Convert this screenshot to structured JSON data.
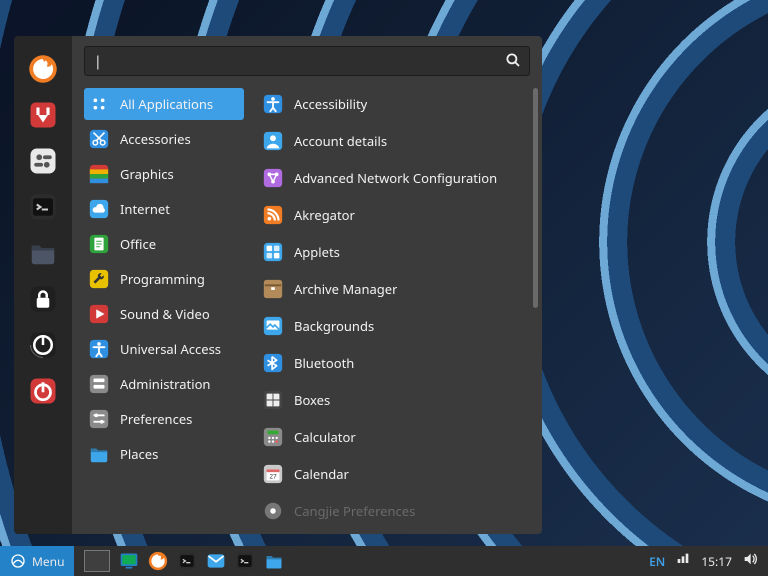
{
  "search": {
    "placeholder": "",
    "value": ""
  },
  "favorites": [
    {
      "name": "firefox",
      "color": "#f07c24"
    },
    {
      "name": "transmission",
      "color": "#d23a3a"
    },
    {
      "name": "settings",
      "color": "#e9e9e9"
    },
    {
      "name": "terminal",
      "color": "#2c2c2c"
    },
    {
      "name": "files",
      "color": "#4b5566"
    },
    {
      "name": "lock",
      "color": "#1f1f1f"
    },
    {
      "name": "logout",
      "color": "#1f1f1f"
    },
    {
      "name": "shutdown",
      "color": "#d23a3a"
    }
  ],
  "categories": [
    {
      "label": "All Applications",
      "icon": "all",
      "color": "#3f9fe6",
      "selected": true
    },
    {
      "label": "Accessories",
      "icon": "scissors",
      "color": "#2f8fe0"
    },
    {
      "label": "Graphics",
      "icon": "rainbow",
      "color": "#ff7f27"
    },
    {
      "label": "Internet",
      "icon": "cloud",
      "color": "#3ea6ea"
    },
    {
      "label": "Office",
      "icon": "doc",
      "color": "#2fa33b"
    },
    {
      "label": "Programming",
      "icon": "wrench",
      "color": "#e8c100"
    },
    {
      "label": "Sound & Video",
      "icon": "play",
      "color": "#d23a3a"
    },
    {
      "label": "Universal Access",
      "icon": "access",
      "color": "#2f8fe0"
    },
    {
      "label": "Administration",
      "icon": "admin",
      "color": "#8a8a8a"
    },
    {
      "label": "Preferences",
      "icon": "prefs",
      "color": "#8a8a8a"
    },
    {
      "label": "Places",
      "icon": "folder",
      "color": "#3ea6ea"
    }
  ],
  "apps": [
    {
      "label": "Accessibility",
      "icon": "access",
      "color": "#2f8fe0"
    },
    {
      "label": "Account details",
      "icon": "avatar",
      "color": "#3ea6ea"
    },
    {
      "label": "Advanced Network Configuration",
      "icon": "netadv",
      "color": "#b06be0"
    },
    {
      "label": "Akregator",
      "icon": "rss",
      "color": "#f07c24"
    },
    {
      "label": "Applets",
      "icon": "applets",
      "color": "#3ea6ea"
    },
    {
      "label": "Archive Manager",
      "icon": "archive",
      "color": "#b38b5a"
    },
    {
      "label": "Backgrounds",
      "icon": "bg",
      "color": "#3ea6ea"
    },
    {
      "label": "Bluetooth",
      "icon": "bt",
      "color": "#2f8fe0"
    },
    {
      "label": "Boxes",
      "icon": "boxes",
      "color": "#eeeeee"
    },
    {
      "label": "Calculator",
      "icon": "calc",
      "color": "#8a8a8a"
    },
    {
      "label": "Calendar",
      "icon": "cal",
      "color": "#c9c9c9"
    },
    {
      "label": "Cangjie Preferences",
      "icon": "cog",
      "color": "#777",
      "faded": true
    }
  ],
  "panel": {
    "menu_label": "Menu",
    "pins": [
      {
        "name": "show-desktop",
        "color": "#2382c8"
      },
      {
        "name": "firefox",
        "color": "#f07c24"
      },
      {
        "name": "terminal",
        "color": "#2c2c2c"
      },
      {
        "name": "mail",
        "color": "#3ea6ea"
      },
      {
        "name": "terminal2",
        "color": "#2c2c2c"
      },
      {
        "name": "files",
        "color": "#3ea6ea"
      }
    ],
    "lang": "EN",
    "clock": "15:17"
  }
}
